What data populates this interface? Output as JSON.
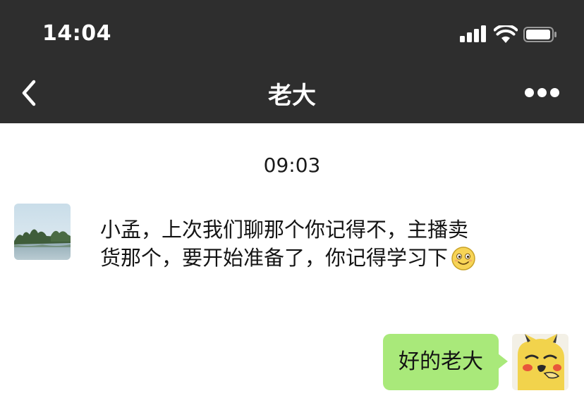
{
  "status_bar": {
    "time": "14:04",
    "icons": [
      "cellular-signal-icon",
      "wifi-icon",
      "battery-icon"
    ]
  },
  "header": {
    "title": "老大",
    "back_icon": "chevron-left-icon",
    "more_icon": "more-horizontal-icon"
  },
  "chat": {
    "timestamp": "09:03",
    "messages": [
      {
        "side": "left",
        "sender_avatar": "lake-landscape-avatar",
        "text": "小孟，上次我们聊那个你记得不，主播卖货那个，要开始准备了，你记得学习下",
        "emoji": "smile-emoji-icon"
      },
      {
        "side": "right",
        "sender_avatar": "cartoon-cat-avatar",
        "text": "好的老大"
      }
    ]
  },
  "colors": {
    "header_bg": "#2e2e2e",
    "chat_bg": "#ffffff",
    "sent_bubble": "#a9e97a"
  }
}
